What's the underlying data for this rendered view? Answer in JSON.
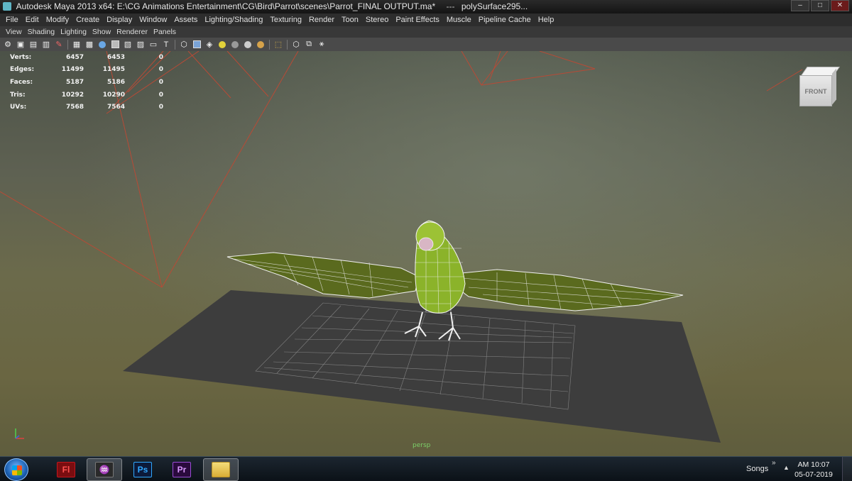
{
  "window": {
    "title": "Autodesk Maya 2013 x64: E:\\CG Animations Entertainment\\CG\\Bird\\Parrot\\scenes\\Parrot_FINAL OUTPUT.ma*",
    "separator": "---",
    "selection": "polySurface295..."
  },
  "main_menu": [
    "File",
    "Edit",
    "Modify",
    "Create",
    "Display",
    "Window",
    "Assets",
    "Lighting/Shading",
    "Texturing",
    "Render",
    "Toon",
    "Stereo",
    "Paint Effects",
    "Muscle",
    "Pipeline Cache",
    "Help"
  ],
  "panel_menu": [
    "View",
    "Shading",
    "Lighting",
    "Show",
    "Renderer",
    "Panels"
  ],
  "toolbar_icons": [
    "camera-icon",
    "camera-attr-icon",
    "bookmark-icon",
    "image-plane-icon",
    "camera-move-icon",
    "grid-toggle-icon",
    "wireframe-icon",
    "smooth-shade-icon",
    "shade-all-icon",
    "wireframe-on-shaded-icon",
    "xray-icon",
    "texture-icon",
    "default-light-icon",
    "all-lights-icon",
    "shadow-icon",
    "high-quality-icon",
    "isolate-select-icon",
    "cube-icon",
    "frame-all-icon",
    "share-icon"
  ],
  "hud": {
    "rows": [
      {
        "label": "Verts:",
        "v1": "6457",
        "v2": "6453",
        "v3": "0"
      },
      {
        "label": "Edges:",
        "v1": "11499",
        "v2": "11495",
        "v3": "0"
      },
      {
        "label": "Faces:",
        "v1": "5187",
        "v2": "5186",
        "v3": "0"
      },
      {
        "label": "Tris:",
        "v1": "10292",
        "v2": "10290",
        "v3": "0"
      },
      {
        "label": "UVs:",
        "v1": "7568",
        "v2": "7564",
        "v3": "0"
      }
    ]
  },
  "viewcube_label": "FRONT",
  "camera_label": "persp",
  "taskbar": {
    "apps": [
      {
        "name": "flash",
        "text": "Fl",
        "color": "#c5161d"
      },
      {
        "name": "maya",
        "text": "",
        "color": "#2a2a2a",
        "active": true
      },
      {
        "name": "photoshop",
        "text": "Ps",
        "color": "#0c1a3a",
        "fg": "#31a8ff"
      },
      {
        "name": "premiere",
        "text": "Pr",
        "color": "#2a0a3d",
        "fg": "#d999ff"
      },
      {
        "name": "explorer",
        "text": "",
        "color": "#e8c85a"
      }
    ],
    "toolbar_name": "Songs",
    "time": "AM 10:07",
    "date": "05-07-2019"
  }
}
